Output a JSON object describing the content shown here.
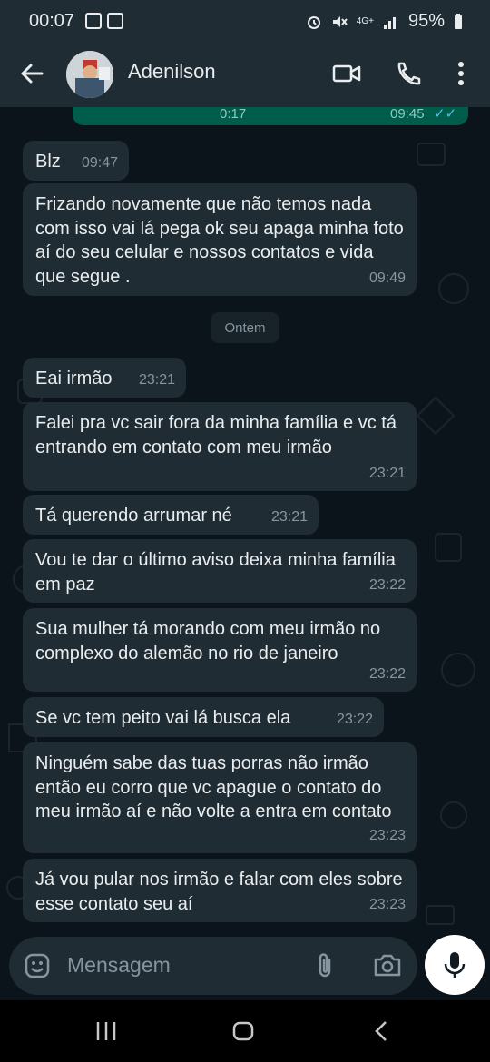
{
  "status_bar": {
    "time": "00:07",
    "network": "4G+",
    "battery": "95%"
  },
  "header": {
    "contact_name": "Adenilson"
  },
  "audio_message": {
    "duration": "0:17",
    "time": "09:45",
    "ticks": "✓✓"
  },
  "date_divider": "Ontem",
  "messages": [
    {
      "text": "Blz",
      "time": "09:47"
    },
    {
      "text": "Frizando novamente que não temos nada com isso vai lá pega ok seu apaga minha foto aí do seu celular e nossos contatos e vida que segue .",
      "time": "09:49"
    },
    {
      "text": "Eai irmão",
      "time": "23:21"
    },
    {
      "text": "Falei pra vc sair fora da minha família e vc tá entrando em contato com meu irmão",
      "time": "23:21"
    },
    {
      "text": "Tá querendo arrumar né",
      "time": "23:21"
    },
    {
      "text": "Vou te dar o último aviso deixa minha família em paz",
      "time": "23:22"
    },
    {
      "text": "Sua mulher tá morando com meu irmão no complexo do alemão no rio de janeiro",
      "time": "23:22"
    },
    {
      "text": "Se vc tem peito vai lá busca ela",
      "time": "23:22"
    },
    {
      "text": "Ninguém sabe das tuas porras não irmão então eu corro que vc apague o contato do meu irmão aí e não volte a entra em contato",
      "time": "23:23"
    },
    {
      "text": "Já vou pular nos irmão e falar com eles sobre esse contato seu aí",
      "time": "23:23"
    }
  ],
  "input": {
    "placeholder": "Mensagem"
  },
  "colors": {
    "bubble_incoming": "#202c33",
    "bubble_outgoing": "#005c4b",
    "background": "#0b141a",
    "bar": "#1f2c34"
  }
}
